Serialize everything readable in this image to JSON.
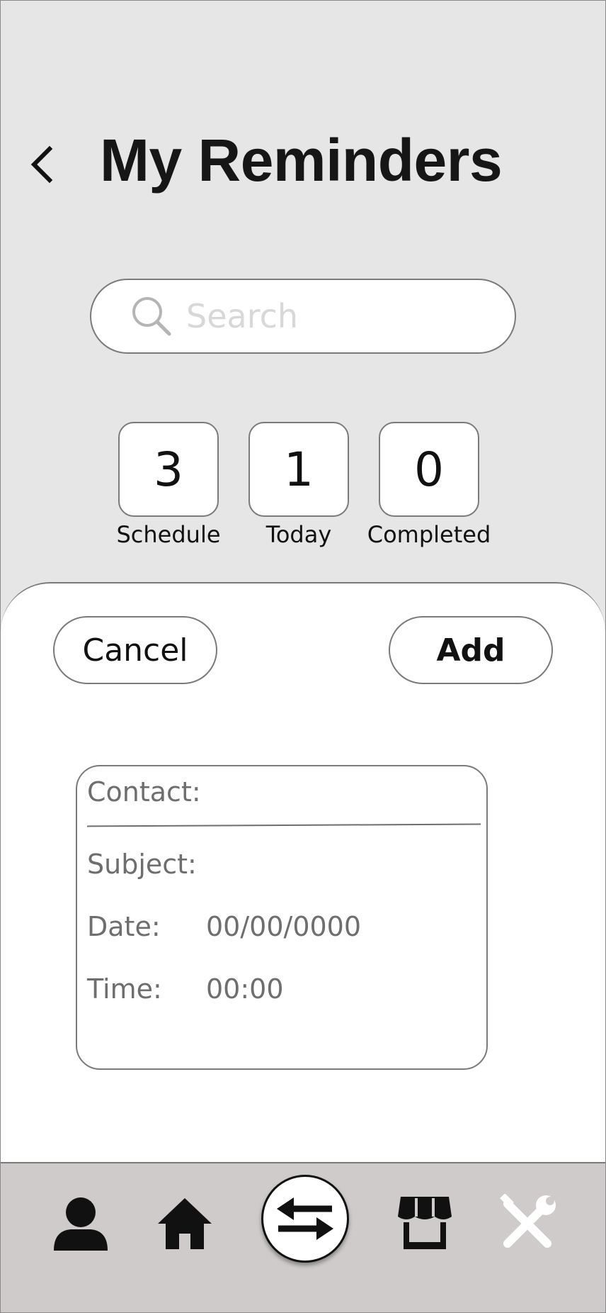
{
  "header": {
    "title": "My Reminders",
    "back_icon": "chevron-left-icon"
  },
  "search": {
    "placeholder": "Search",
    "value": "",
    "icon": "search-icon"
  },
  "stats": [
    {
      "value": "3",
      "label": "Schedule"
    },
    {
      "value": "1",
      "label": "Today"
    },
    {
      "value": "0",
      "label": "Completed"
    }
  ],
  "sheet": {
    "cancel_label": "Cancel",
    "add_label": "Add"
  },
  "form": {
    "contact_label": "Contact:",
    "contact_value": "",
    "subject_label": "Subject:",
    "subject_value": "",
    "date_label": "Date:",
    "date_value": "00/00/0000",
    "time_label": "Time:",
    "time_value": "00:00"
  },
  "nav": {
    "items": [
      {
        "icon": "person-icon",
        "color": "#111111"
      },
      {
        "icon": "home-icon",
        "color": "#111111"
      },
      {
        "icon": "swap-arrows-icon",
        "color": "#111111",
        "active": true
      },
      {
        "icon": "store-icon",
        "color": "#111111"
      },
      {
        "icon": "tools-icon",
        "color": "#ffffff"
      }
    ]
  },
  "colors": {
    "background": "#e6e6e6",
    "sheet": "#ffffff",
    "nav_bar": "#cfcbcb",
    "border": "#7a7a7a",
    "placeholder": "#d8d8d8",
    "form_text": "#6e6e6e"
  }
}
